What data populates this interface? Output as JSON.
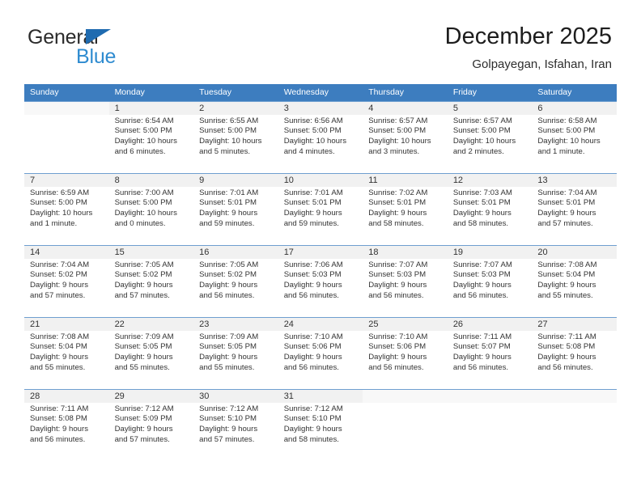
{
  "brand": {
    "name_top": "General",
    "name_bottom": "Blue",
    "accent_color": "#2e8bd0",
    "triangle_color": "#1f6bb0"
  },
  "header": {
    "title": "December 2025",
    "subtitle": "Golpayegan, Isfahan, Iran"
  },
  "calendar": {
    "header_bg": "#3d7dbf",
    "daynum_bg": "#f1f1f1",
    "weekdays": [
      "Sunday",
      "Monday",
      "Tuesday",
      "Wednesday",
      "Thursday",
      "Friday",
      "Saturday"
    ],
    "weeks": [
      [
        {
          "day": "",
          "sunrise": "",
          "sunset": "",
          "daylight_1": "",
          "daylight_2": ""
        },
        {
          "day": "1",
          "sunrise": "Sunrise: 6:54 AM",
          "sunset": "Sunset: 5:00 PM",
          "daylight_1": "Daylight: 10 hours",
          "daylight_2": "and 6 minutes."
        },
        {
          "day": "2",
          "sunrise": "Sunrise: 6:55 AM",
          "sunset": "Sunset: 5:00 PM",
          "daylight_1": "Daylight: 10 hours",
          "daylight_2": "and 5 minutes."
        },
        {
          "day": "3",
          "sunrise": "Sunrise: 6:56 AM",
          "sunset": "Sunset: 5:00 PM",
          "daylight_1": "Daylight: 10 hours",
          "daylight_2": "and 4 minutes."
        },
        {
          "day": "4",
          "sunrise": "Sunrise: 6:57 AM",
          "sunset": "Sunset: 5:00 PM",
          "daylight_1": "Daylight: 10 hours",
          "daylight_2": "and 3 minutes."
        },
        {
          "day": "5",
          "sunrise": "Sunrise: 6:57 AM",
          "sunset": "Sunset: 5:00 PM",
          "daylight_1": "Daylight: 10 hours",
          "daylight_2": "and 2 minutes."
        },
        {
          "day": "6",
          "sunrise": "Sunrise: 6:58 AM",
          "sunset": "Sunset: 5:00 PM",
          "daylight_1": "Daylight: 10 hours",
          "daylight_2": "and 1 minute."
        }
      ],
      [
        {
          "day": "7",
          "sunrise": "Sunrise: 6:59 AM",
          "sunset": "Sunset: 5:00 PM",
          "daylight_1": "Daylight: 10 hours",
          "daylight_2": "and 1 minute."
        },
        {
          "day": "8",
          "sunrise": "Sunrise: 7:00 AM",
          "sunset": "Sunset: 5:00 PM",
          "daylight_1": "Daylight: 10 hours",
          "daylight_2": "and 0 minutes."
        },
        {
          "day": "9",
          "sunrise": "Sunrise: 7:01 AM",
          "sunset": "Sunset: 5:01 PM",
          "daylight_1": "Daylight: 9 hours",
          "daylight_2": "and 59 minutes."
        },
        {
          "day": "10",
          "sunrise": "Sunrise: 7:01 AM",
          "sunset": "Sunset: 5:01 PM",
          "daylight_1": "Daylight: 9 hours",
          "daylight_2": "and 59 minutes."
        },
        {
          "day": "11",
          "sunrise": "Sunrise: 7:02 AM",
          "sunset": "Sunset: 5:01 PM",
          "daylight_1": "Daylight: 9 hours",
          "daylight_2": "and 58 minutes."
        },
        {
          "day": "12",
          "sunrise": "Sunrise: 7:03 AM",
          "sunset": "Sunset: 5:01 PM",
          "daylight_1": "Daylight: 9 hours",
          "daylight_2": "and 58 minutes."
        },
        {
          "day": "13",
          "sunrise": "Sunrise: 7:04 AM",
          "sunset": "Sunset: 5:01 PM",
          "daylight_1": "Daylight: 9 hours",
          "daylight_2": "and 57 minutes."
        }
      ],
      [
        {
          "day": "14",
          "sunrise": "Sunrise: 7:04 AM",
          "sunset": "Sunset: 5:02 PM",
          "daylight_1": "Daylight: 9 hours",
          "daylight_2": "and 57 minutes."
        },
        {
          "day": "15",
          "sunrise": "Sunrise: 7:05 AM",
          "sunset": "Sunset: 5:02 PM",
          "daylight_1": "Daylight: 9 hours",
          "daylight_2": "and 57 minutes."
        },
        {
          "day": "16",
          "sunrise": "Sunrise: 7:05 AM",
          "sunset": "Sunset: 5:02 PM",
          "daylight_1": "Daylight: 9 hours",
          "daylight_2": "and 56 minutes."
        },
        {
          "day": "17",
          "sunrise": "Sunrise: 7:06 AM",
          "sunset": "Sunset: 5:03 PM",
          "daylight_1": "Daylight: 9 hours",
          "daylight_2": "and 56 minutes."
        },
        {
          "day": "18",
          "sunrise": "Sunrise: 7:07 AM",
          "sunset": "Sunset: 5:03 PM",
          "daylight_1": "Daylight: 9 hours",
          "daylight_2": "and 56 minutes."
        },
        {
          "day": "19",
          "sunrise": "Sunrise: 7:07 AM",
          "sunset": "Sunset: 5:03 PM",
          "daylight_1": "Daylight: 9 hours",
          "daylight_2": "and 56 minutes."
        },
        {
          "day": "20",
          "sunrise": "Sunrise: 7:08 AM",
          "sunset": "Sunset: 5:04 PM",
          "daylight_1": "Daylight: 9 hours",
          "daylight_2": "and 55 minutes."
        }
      ],
      [
        {
          "day": "21",
          "sunrise": "Sunrise: 7:08 AM",
          "sunset": "Sunset: 5:04 PM",
          "daylight_1": "Daylight: 9 hours",
          "daylight_2": "and 55 minutes."
        },
        {
          "day": "22",
          "sunrise": "Sunrise: 7:09 AM",
          "sunset": "Sunset: 5:05 PM",
          "daylight_1": "Daylight: 9 hours",
          "daylight_2": "and 55 minutes."
        },
        {
          "day": "23",
          "sunrise": "Sunrise: 7:09 AM",
          "sunset": "Sunset: 5:05 PM",
          "daylight_1": "Daylight: 9 hours",
          "daylight_2": "and 55 minutes."
        },
        {
          "day": "24",
          "sunrise": "Sunrise: 7:10 AM",
          "sunset": "Sunset: 5:06 PM",
          "daylight_1": "Daylight: 9 hours",
          "daylight_2": "and 56 minutes."
        },
        {
          "day": "25",
          "sunrise": "Sunrise: 7:10 AM",
          "sunset": "Sunset: 5:06 PM",
          "daylight_1": "Daylight: 9 hours",
          "daylight_2": "and 56 minutes."
        },
        {
          "day": "26",
          "sunrise": "Sunrise: 7:11 AM",
          "sunset": "Sunset: 5:07 PM",
          "daylight_1": "Daylight: 9 hours",
          "daylight_2": "and 56 minutes."
        },
        {
          "day": "27",
          "sunrise": "Sunrise: 7:11 AM",
          "sunset": "Sunset: 5:08 PM",
          "daylight_1": "Daylight: 9 hours",
          "daylight_2": "and 56 minutes."
        }
      ],
      [
        {
          "day": "28",
          "sunrise": "Sunrise: 7:11 AM",
          "sunset": "Sunset: 5:08 PM",
          "daylight_1": "Daylight: 9 hours",
          "daylight_2": "and 56 minutes."
        },
        {
          "day": "29",
          "sunrise": "Sunrise: 7:12 AM",
          "sunset": "Sunset: 5:09 PM",
          "daylight_1": "Daylight: 9 hours",
          "daylight_2": "and 57 minutes."
        },
        {
          "day": "30",
          "sunrise": "Sunrise: 7:12 AM",
          "sunset": "Sunset: 5:10 PM",
          "daylight_1": "Daylight: 9 hours",
          "daylight_2": "and 57 minutes."
        },
        {
          "day": "31",
          "sunrise": "Sunrise: 7:12 AM",
          "sunset": "Sunset: 5:10 PM",
          "daylight_1": "Daylight: 9 hours",
          "daylight_2": "and 58 minutes."
        },
        {
          "day": "",
          "sunrise": "",
          "sunset": "",
          "daylight_1": "",
          "daylight_2": ""
        },
        {
          "day": "",
          "sunrise": "",
          "sunset": "",
          "daylight_1": "",
          "daylight_2": ""
        },
        {
          "day": "",
          "sunrise": "",
          "sunset": "",
          "daylight_1": "",
          "daylight_2": ""
        }
      ]
    ]
  }
}
